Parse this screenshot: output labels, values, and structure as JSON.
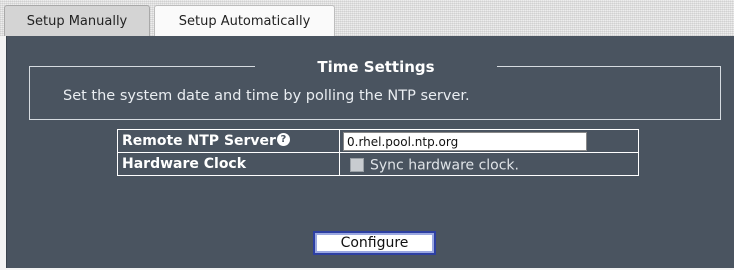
{
  "tabs": [
    {
      "label": "Setup Manually"
    },
    {
      "label": "Setup Automatically"
    }
  ],
  "section": {
    "title": "Time Settings",
    "description": "Set the system date and time by polling the NTP server."
  },
  "form": {
    "ntp_label": "Remote NTP Server",
    "ntp_help_glyph": "?",
    "ntp_value": "0.rhel.pool.ntp.org",
    "hw_label": "Hardware Clock",
    "sync_label": "Sync hardware clock."
  },
  "actions": {
    "configure_label": "Configure"
  }
}
